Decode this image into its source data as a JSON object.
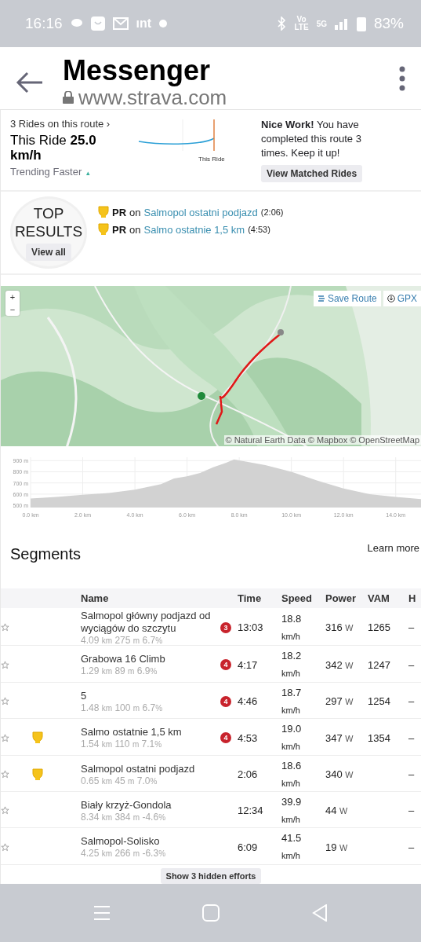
{
  "status_bar": {
    "time": "16:16",
    "notif_text": "ınt",
    "network": "Vo\nLTE",
    "signal": "5G",
    "battery": "83%"
  },
  "browser_bar": {
    "title": "Messenger",
    "url": "www.strava.com"
  },
  "summary": {
    "rides_link": "3 Rides on this route ›",
    "this_ride_label": "This Ride",
    "this_ride_value": "25.0 km/h",
    "trend": "Trending Faster",
    "trend_mark": "▴",
    "sparkline_label": "This Ride",
    "message": "**Nice Work!** You have completed this route 3 times. Keep it up!",
    "button": "View Matched Rides"
  },
  "top_results": {
    "title": "TOP RESULTS",
    "button": "View all",
    "items": [
      {
        "badge": "PR",
        "joiner": "on",
        "segment": "Salmopol ostatni podjazd",
        "time": "(2:06)"
      },
      {
        "badge": "PR",
        "joiner": "on",
        "segment": "Salmo ostatnie 1,5 km",
        "time": "(4:53)"
      }
    ]
  },
  "map": {
    "zoom_in": "+",
    "zoom_out": "−",
    "save_route": "Save Route",
    "gpx": "GPX",
    "attribution": "© Natural Earth Data © Mapbox © OpenStreetMap"
  },
  "elevation": {
    "chart_data": {
      "type": "area",
      "x": [
        0,
        1,
        2,
        3,
        4,
        5,
        5.5,
        6,
        6.5,
        7,
        7.5,
        7.8,
        8.5,
        9,
        10,
        11,
        12,
        13,
        14,
        15
      ],
      "grid": true,
      "series": [
        {
          "color": "#d2d2d2",
          "values": [
            560,
            575,
            595,
            610,
            640,
            690,
            740,
            760,
            790,
            840,
            880,
            910,
            880,
            860,
            800,
            720,
            650,
            600,
            575,
            555
          ]
        }
      ],
      "xlim": [
        0,
        15
      ],
      "ylim": [
        480,
        930
      ],
      "xticks": [
        {
          "value": 0,
          "label": "0.0 km"
        },
        {
          "value": 2,
          "label": "2.0 km"
        },
        {
          "value": 4,
          "label": "4.0 km"
        },
        {
          "value": 6,
          "label": "6.0 km"
        },
        {
          "value": 8,
          "label": "8.0 km"
        },
        {
          "value": 10,
          "label": "10.0 km"
        },
        {
          "value": 12,
          "label": "12.0 km"
        },
        {
          "value": 14,
          "label": "14.0 km"
        }
      ],
      "yticks": [
        {
          "value": 500,
          "label": "500 m"
        },
        {
          "value": 600,
          "label": "600 m"
        },
        {
          "value": 700,
          "label": "700 m"
        },
        {
          "value": 800,
          "label": "800 m"
        },
        {
          "value": 900,
          "label": "900 m"
        }
      ]
    }
  },
  "segments": {
    "title": "Segments",
    "learn_more": "Learn more",
    "columns": [
      "Name",
      "Time",
      "Speed",
      "Power",
      "VAM",
      "H"
    ],
    "rows": [
      {
        "pr": false,
        "name": "Salmopol główny podjazd od wyciągów do szczytu",
        "distance": "4.09",
        "distance_unit": "km",
        "elev": "275",
        "elev_unit": "m",
        "grade": "6.7",
        "grade_unit": "%",
        "category": "3",
        "time": "13:03",
        "speed": "18.8",
        "speed_unit": "km/h",
        "power": "316",
        "power_unit": "W",
        "vam": "1265",
        "extra": "–"
      },
      {
        "pr": false,
        "name": "Grabowa 16 Climb",
        "distance": "1.29",
        "distance_unit": "km",
        "elev": "89",
        "elev_unit": "m",
        "grade": "6.9",
        "grade_unit": "%",
        "category": "4",
        "time": "4:17",
        "speed": "18.2",
        "speed_unit": "km/h",
        "power": "342",
        "power_unit": "W",
        "vam": "1247",
        "extra": "–"
      },
      {
        "pr": false,
        "name": "5",
        "distance": "1.48",
        "distance_unit": "km",
        "elev": "100",
        "elev_unit": "m",
        "grade": "6.7",
        "grade_unit": "%",
        "category": "4",
        "time": "4:46",
        "speed": "18.7",
        "speed_unit": "km/h",
        "power": "297",
        "power_unit": "W",
        "vam": "1254",
        "extra": "–"
      },
      {
        "pr": true,
        "name": "Salmo ostatnie 1,5 km",
        "distance": "1.54",
        "distance_unit": "km",
        "elev": "110",
        "elev_unit": "m",
        "grade": "7.1",
        "grade_unit": "%",
        "category": "4",
        "time": "4:53",
        "speed": "19.0",
        "speed_unit": "km/h",
        "power": "347",
        "power_unit": "W",
        "vam": "1354",
        "extra": "–"
      },
      {
        "pr": true,
        "name": "Salmopol ostatni podjazd",
        "distance": "0.65",
        "distance_unit": "km",
        "elev": "45",
        "elev_unit": "m",
        "grade": "7.0",
        "grade_unit": "%",
        "time": "2:06",
        "speed": "18.6",
        "speed_unit": "km/h",
        "power": "340",
        "power_unit": "W",
        "extra": "–"
      },
      {
        "pr": false,
        "name": "Biały krzyż-Gondola",
        "distance": "8.34",
        "distance_unit": "km",
        "elev": "384",
        "elev_unit": "m",
        "grade": "-4.6",
        "grade_unit": "%",
        "time": "12:34",
        "speed": "39.9",
        "speed_unit": "km/h",
        "power": "44",
        "power_unit": "W",
        "extra": "–"
      },
      {
        "pr": false,
        "name": "Salmopol-Solisko",
        "distance": "4.25",
        "distance_unit": "km",
        "elev": "266",
        "elev_unit": "m",
        "grade": "-6.3",
        "grade_unit": "%",
        "time": "6:09",
        "speed": "41.5",
        "speed_unit": "km/h",
        "power": "19",
        "power_unit": "W",
        "extra": "–"
      }
    ],
    "show_hidden": "Show 3 hidden efforts"
  }
}
